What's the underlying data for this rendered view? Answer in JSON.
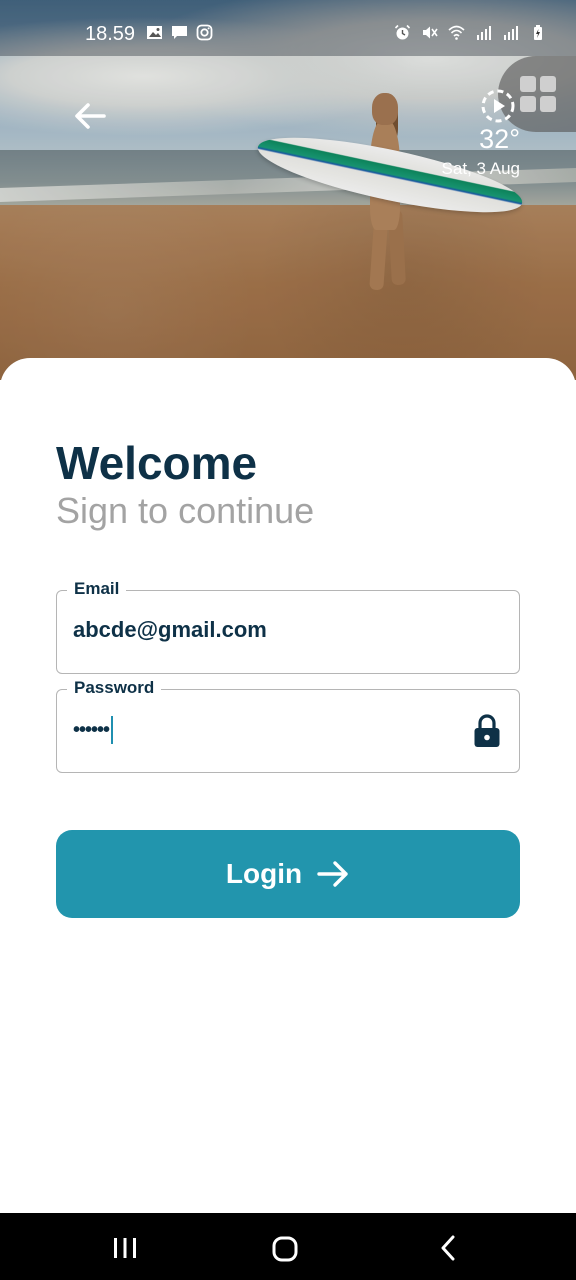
{
  "status_bar": {
    "time": "18.59",
    "left_icons": [
      "gallery-icon",
      "message-icon",
      "instagram-icon"
    ],
    "right_icons": [
      "alarm-icon",
      "mute-icon",
      "wifi-icon",
      "signal-icon",
      "signal-icon",
      "battery-icon"
    ]
  },
  "header": {
    "back_icon": "arrow-left-icon",
    "apps_icon": "apps-grid-icon",
    "weather": {
      "icon": "weather-sun-icon",
      "temperature": "32°",
      "date": "Sat, 3 Aug"
    }
  },
  "login": {
    "title": "Welcome",
    "subtitle": "Sign to continue",
    "email": {
      "label": "Email",
      "value": "abcde@gmail.com"
    },
    "password": {
      "label": "Password",
      "value": "••••••",
      "icon": "lock-icon"
    },
    "button": {
      "label": "Login",
      "icon": "arrow-right-icon"
    }
  },
  "nav_bar": {
    "icons": [
      "recents-icon",
      "home-icon",
      "back-icon"
    ]
  },
  "colors": {
    "primary": "#2295ad",
    "title": "#0e3147",
    "subtitle": "#a3a3a3",
    "border": "#b5b5b5"
  }
}
